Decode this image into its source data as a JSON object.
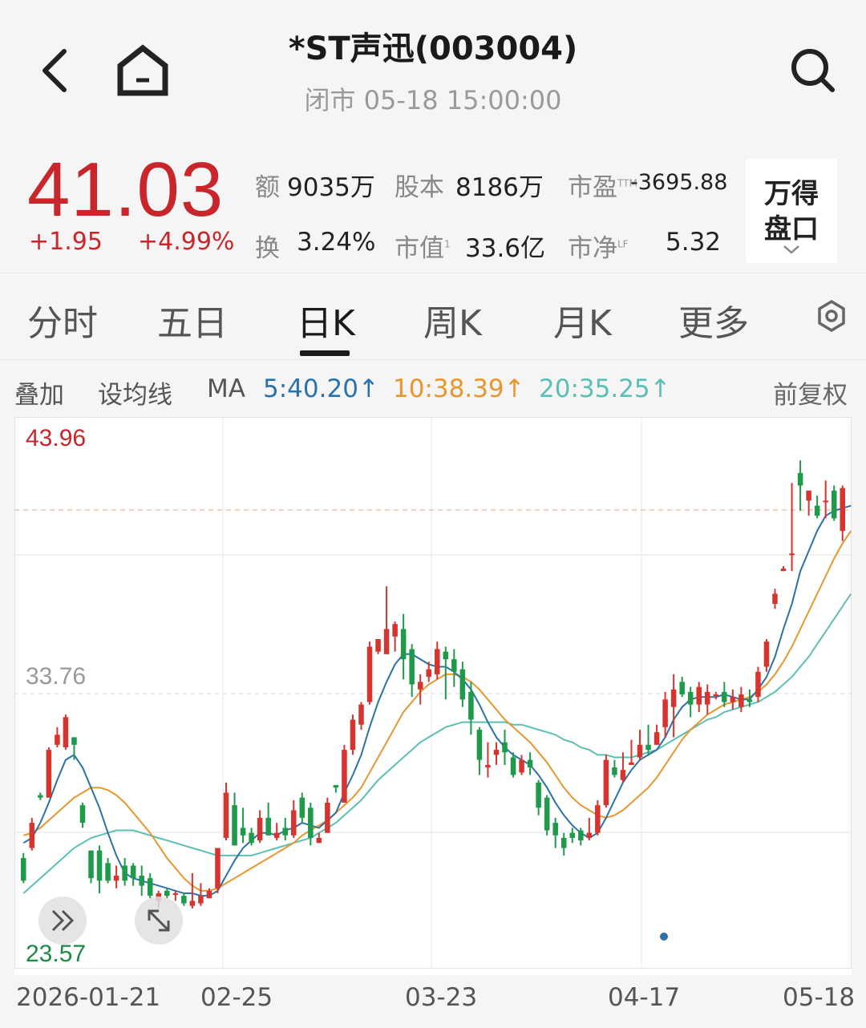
{
  "header": {
    "title": "*ST声迅(003004)",
    "subtitle": "闭市 05-18 15:00:00"
  },
  "quote": {
    "price": "41.03",
    "change": "+1.95",
    "change_pct": "+4.99%",
    "amount_label": "额",
    "amount_value": "9035万",
    "share_label": "股本",
    "share_value": "8186万",
    "pe_label": "市盈",
    "pe_sup": "TTM",
    "pe_value": "-3695.88",
    "turnover_label": "换",
    "turnover_value": "3.24%",
    "mktcap_label": "市值",
    "mktcap_sup": "1",
    "mktcap_value": "33.6亿",
    "pb_label": "市净",
    "pb_sup": "LF",
    "pb_value": "5.32",
    "pankou_line1": "万得",
    "pankou_line2": "盘口"
  },
  "tabs": [
    "分时",
    "五日",
    "日K",
    "周K",
    "月K",
    "更多"
  ],
  "active_tab": "日K",
  "ma_bar": {
    "overlay": "叠加",
    "set_ma": "设均线",
    "ma_label": "MA",
    "ma5": "5:40.20↑",
    "ma10": "10:38.39↑",
    "ma20": "20:35.25↑",
    "adjust": "前复权"
  },
  "colors": {
    "up": "#d5342f",
    "down": "#1e9a4a",
    "ma5": "#2a72a8",
    "ma10": "#e8962e",
    "ma20": "#5bbfb3",
    "price": "#c8262a"
  },
  "icons": [
    "back-arrow-icon",
    "home-icon",
    "search-icon",
    "settings-gear-icon",
    "chevron-down-icon",
    "double-chevron-right-icon",
    "expand-arrows-icon"
  ],
  "chart_data": {
    "type": "candlestick",
    "y_labels": {
      "top": "43.96",
      "mid": "33.76",
      "bottom": "23.57"
    },
    "ylim": [
      23.57,
      43.96
    ],
    "x_labels": [
      "2026-01-21",
      "02-25",
      "03-23",
      "04-17",
      "05-18"
    ],
    "last_close": 41.03,
    "candles": [
      [
        27.2,
        26.3,
        27.4,
        26.2
      ],
      [
        27.6,
        28.6,
        28.8,
        27.5
      ],
      [
        29.7,
        29.6,
        29.8,
        29.5
      ],
      [
        29.6,
        31.5,
        31.6,
        29.6
      ],
      [
        31.7,
        32.1,
        32.4,
        31.6
      ],
      [
        31.6,
        32.8,
        32.9,
        31.5
      ],
      [
        32.0,
        31.7,
        32.0,
        31.1
      ],
      [
        29.3,
        28.6,
        29.4,
        28.4
      ],
      [
        27.5,
        26.4,
        27.5,
        26.2
      ],
      [
        27.5,
        26.3,
        27.7,
        25.8
      ],
      [
        27.0,
        26.3,
        27.2,
        26.2
      ],
      [
        26.3,
        26.5,
        26.9,
        26.0
      ],
      [
        26.9,
        26.3,
        27.2,
        26.1
      ],
      [
        26.9,
        26.4,
        27.0,
        26.1
      ],
      [
        26.5,
        26.1,
        26.9,
        25.7
      ],
      [
        26.4,
        25.7,
        26.6,
        25.6
      ],
      [
        25.5,
        25.8,
        25.9,
        25.2
      ],
      [
        25.9,
        25.7,
        26.0,
        25.6
      ],
      [
        25.8,
        25.8,
        25.9,
        25.5
      ],
      [
        25.7,
        25.4,
        25.8,
        25.3
      ],
      [
        25.3,
        25.5,
        26.6,
        25.2
      ],
      [
        25.4,
        25.7,
        26.2,
        25.3
      ],
      [
        25.6,
        25.9,
        26.0,
        25.6
      ],
      [
        26.0,
        27.6,
        27.6,
        25.8
      ],
      [
        28.0,
        29.8,
        30.2,
        27.9
      ],
      [
        29.3,
        27.7,
        29.8,
        27.7
      ],
      [
        28.4,
        28.1,
        29.2,
        27.8
      ],
      [
        28.2,
        27.8,
        28.4,
        27.7
      ],
      [
        27.9,
        28.8,
        29.1,
        27.8
      ],
      [
        28.8,
        28.1,
        29.4,
        28.1
      ],
      [
        28.0,
        28.2,
        28.6,
        27.9
      ],
      [
        28.4,
        28.1,
        28.8,
        27.9
      ],
      [
        28.1,
        29.1,
        29.5,
        28.0
      ],
      [
        29.6,
        28.8,
        29.8,
        28.6
      ],
      [
        29.2,
        28.0,
        29.4,
        27.7
      ],
      [
        27.8,
        28.0,
        28.2,
        27.8
      ],
      [
        28.2,
        29.4,
        29.6,
        28.2
      ],
      [
        30.1,
        30.0,
        30.1,
        29.8
      ],
      [
        29.4,
        31.5,
        31.7,
        29.4
      ],
      [
        31.5,
        32.7,
        32.9,
        31.3
      ],
      [
        32.5,
        33.3,
        33.4,
        32.3
      ],
      [
        33.4,
        35.6,
        35.8,
        33.3
      ],
      [
        35.4,
        35.9,
        35.9,
        35.3
      ],
      [
        35.3,
        36.3,
        38.0,
        35.3
      ],
      [
        36.0,
        36.5,
        36.6,
        35.4
      ],
      [
        36.3,
        35.1,
        36.9,
        34.3
      ],
      [
        35.5,
        34.1,
        35.7,
        33.6
      ],
      [
        33.9,
        34.2,
        34.5,
        33.3
      ],
      [
        34.4,
        34.7,
        35.0,
        34.2
      ],
      [
        34.5,
        35.5,
        35.8,
        34.3
      ],
      [
        35.4,
        35.1,
        35.6,
        33.5
      ],
      [
        35.1,
        34.6,
        35.5,
        34.0
      ],
      [
        34.7,
        33.5,
        35.0,
        33.2
      ],
      [
        33.8,
        32.7,
        34.2,
        32.1
      ],
      [
        32.3,
        31.1,
        32.4,
        30.5
      ],
      [
        30.8,
        30.9,
        31.8,
        30.4
      ],
      [
        31.3,
        31.5,
        31.8,
        30.9
      ],
      [
        31.8,
        31.4,
        32.3,
        30.9
      ],
      [
        31.2,
        30.5,
        31.4,
        30.4
      ],
      [
        30.6,
        31.1,
        31.3,
        30.5
      ],
      [
        31.1,
        30.8,
        31.4,
        30.5
      ],
      [
        30.2,
        29.2,
        30.3,
        28.9
      ],
      [
        29.6,
        28.3,
        29.7,
        28.1
      ],
      [
        28.6,
        28.1,
        28.8,
        27.6
      ],
      [
        28.0,
        27.6,
        28.2,
        27.3
      ],
      [
        28.2,
        28.0,
        28.4,
        27.8
      ],
      [
        28.3,
        27.9,
        28.4,
        27.7
      ],
      [
        28.0,
        28.2,
        28.8,
        27.9
      ],
      [
        28.2,
        29.3,
        29.5,
        28.1
      ],
      [
        29.3,
        31.1,
        31.3,
        29.2
      ],
      [
        30.8,
        30.5,
        31.1,
        30.4
      ],
      [
        30.3,
        30.7,
        31.4,
        30.2
      ],
      [
        30.9,
        31.0,
        31.9,
        30.9
      ],
      [
        31.2,
        31.7,
        32.3,
        31.1
      ],
      [
        31.7,
        31.5,
        32.5,
        31.3
      ],
      [
        31.7,
        32.2,
        32.5,
        31.7
      ],
      [
        32.4,
        33.5,
        33.8,
        32.0
      ],
      [
        33.2,
        33.9,
        34.5,
        32.0
      ],
      [
        34.2,
        33.7,
        34.4,
        33.6
      ],
      [
        33.8,
        33.3,
        34.0,
        32.8
      ],
      [
        33.3,
        34.0,
        34.2,
        33.0
      ],
      [
        33.3,
        33.8,
        34.1,
        32.9
      ],
      [
        33.7,
        33.7,
        33.8,
        33.5
      ],
      [
        33.8,
        33.4,
        34.2,
        33.2
      ],
      [
        33.4,
        33.6,
        33.9,
        33.1
      ],
      [
        33.2,
        33.7,
        34.0,
        33.0
      ],
      [
        33.5,
        33.4,
        33.9,
        33.2
      ],
      [
        33.6,
        34.6,
        34.8,
        33.4
      ],
      [
        34.8,
        35.8,
        35.9,
        34.6
      ],
      [
        37.3,
        37.7,
        37.9,
        37.1
      ],
      [
        38.6,
        38.7,
        38.8,
        38.6
      ],
      [
        39.3,
        39.3,
        42.1,
        38.6
      ],
      [
        42.5,
        42.0,
        43.0,
        41.0
      ],
      [
        41.4,
        41.8,
        41.8,
        40.8
      ],
      [
        41.2,
        40.8,
        41.6,
        40.7
      ],
      [
        41.4,
        41.4,
        42.2,
        40.7
      ],
      [
        41.8,
        40.7,
        42.0,
        40.6
      ],
      [
        40.2,
        41.9,
        42.0,
        39.8
      ]
    ],
    "ma5": [
      27.8,
      28.0,
      28.6,
      29.4,
      30.3,
      31.1,
      31.3,
      30.8,
      30.0,
      29.2,
      28.2,
      27.3,
      26.6,
      26.4,
      26.3,
      26.2,
      26.1,
      26.0,
      25.9,
      25.8,
      25.8,
      25.7,
      25.7,
      25.9,
      26.5,
      27.1,
      27.6,
      27.9,
      28.2,
      28.2,
      28.1,
      28.3,
      28.4,
      28.6,
      28.5,
      28.4,
      28.7,
      29.0,
      29.8,
      30.5,
      31.3,
      32.4,
      33.4,
      34.2,
      34.9,
      35.3,
      35.3,
      35.1,
      34.9,
      34.8,
      34.8,
      34.6,
      34.3,
      33.9,
      33.3,
      32.6,
      32.0,
      31.6,
      31.3,
      31.1,
      30.9,
      30.5,
      30.0,
      29.4,
      28.9,
      28.5,
      28.2,
      28.0,
      28.2,
      28.8,
      29.5,
      30.2,
      30.7,
      31.1,
      31.3,
      31.5,
      32.0,
      32.7,
      33.2,
      33.5,
      33.6,
      33.6,
      33.6,
      33.7,
      33.6,
      33.5,
      33.5,
      33.9,
      34.4,
      35.2,
      36.3,
      37.3,
      38.6,
      39.4,
      40.2,
      40.8,
      41.0,
      41.1,
      41.2
    ],
    "ma10": [
      28.1,
      28.2,
      28.4,
      28.7,
      29.0,
      29.3,
      29.6,
      29.8,
      30.0,
      30.0,
      29.9,
      29.7,
      29.4,
      29.0,
      28.6,
      28.2,
      27.7,
      27.2,
      26.8,
      26.4,
      26.1,
      25.9,
      25.9,
      26.0,
      26.2,
      26.4,
      26.6,
      26.8,
      27.0,
      27.2,
      27.4,
      27.6,
      27.8,
      28.1,
      28.3,
      28.5,
      28.7,
      29.0,
      29.3,
      29.6,
      30.0,
      30.6,
      31.2,
      31.8,
      32.4,
      33.0,
      33.4,
      33.8,
      34.1,
      34.3,
      34.5,
      34.5,
      34.4,
      34.2,
      33.9,
      33.5,
      33.1,
      32.7,
      32.4,
      32.1,
      31.8,
      31.4,
      31.0,
      30.5,
      30.0,
      29.6,
      29.3,
      29.1,
      28.9,
      28.8,
      28.9,
      29.1,
      29.4,
      29.7,
      30.0,
      30.4,
      30.9,
      31.4,
      31.9,
      32.3,
      32.6,
      32.9,
      33.1,
      33.3,
      33.4,
      33.5,
      33.6,
      33.8,
      34.1,
      34.5,
      35.0,
      35.6,
      36.3,
      37.0,
      37.7,
      38.4,
      39.1,
      39.7,
      40.2
    ],
    "ma20": [
      25.8,
      26.1,
      26.4,
      26.7,
      27.0,
      27.3,
      27.6,
      27.8,
      28.0,
      28.1,
      28.2,
      28.3,
      28.3,
      28.3,
      28.2,
      28.1,
      28.0,
      27.9,
      27.8,
      27.7,
      27.6,
      27.5,
      27.4,
      27.3,
      27.3,
      27.3,
      27.3,
      27.3,
      27.4,
      27.5,
      27.6,
      27.7,
      27.8,
      27.9,
      28.0,
      28.2,
      28.4,
      28.6,
      28.9,
      29.2,
      29.5,
      29.9,
      30.3,
      30.6,
      30.9,
      31.2,
      31.5,
      31.8,
      32.0,
      32.2,
      32.4,
      32.5,
      32.6,
      32.6,
      32.6,
      32.6,
      32.6,
      32.6,
      32.5,
      32.5,
      32.4,
      32.3,
      32.2,
      32.1,
      31.9,
      31.8,
      31.6,
      31.5,
      31.3,
      31.3,
      31.2,
      31.2,
      31.2,
      31.3,
      31.4,
      31.5,
      31.7,
      31.9,
      32.1,
      32.3,
      32.5,
      32.7,
      32.8,
      33.0,
      33.1,
      33.2,
      33.3,
      33.4,
      33.6,
      33.8,
      34.1,
      34.4,
      34.8,
      35.2,
      35.7,
      36.2,
      36.7,
      37.2,
      37.7
    ]
  }
}
